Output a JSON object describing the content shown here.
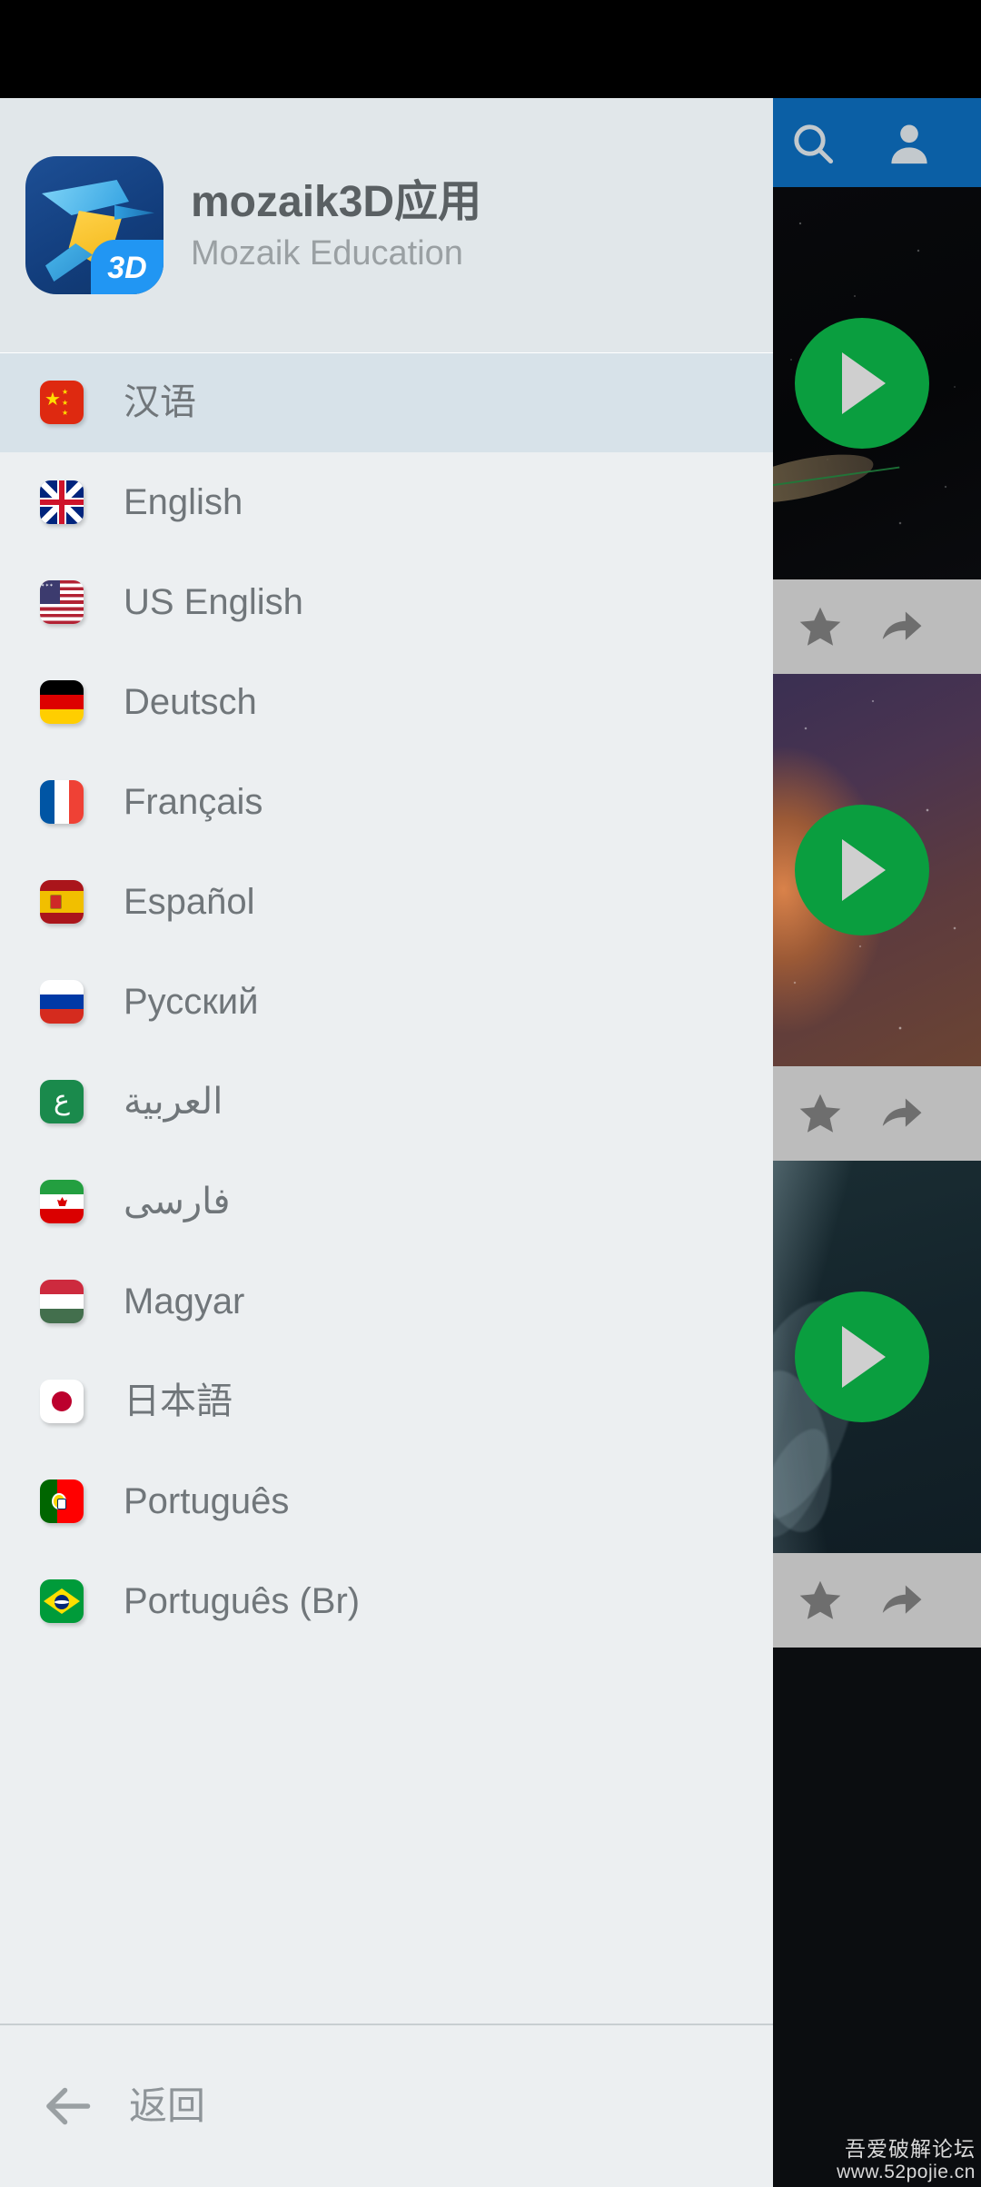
{
  "status_bar": {
    "visible": true
  },
  "drawer": {
    "header": {
      "app_title": "mozaik3D应用",
      "app_subtitle": "Mozaik Education",
      "logo_badge": "3D",
      "logo_icon": "hummingbird-logo"
    },
    "languages": [
      {
        "label": "汉语",
        "flag": "cn",
        "flag_name": "flag-china",
        "selected": true,
        "rtl": false,
        "glyph": ""
      },
      {
        "label": "English",
        "flag": "gb",
        "flag_name": "flag-united-kingdom",
        "selected": false,
        "rtl": false,
        "glyph": ""
      },
      {
        "label": "US English",
        "flag": "us",
        "flag_name": "flag-united-states",
        "selected": false,
        "rtl": false,
        "glyph": ""
      },
      {
        "label": "Deutsch",
        "flag": "de",
        "flag_name": "flag-germany",
        "selected": false,
        "rtl": false,
        "glyph": ""
      },
      {
        "label": "Français",
        "flag": "fr",
        "flag_name": "flag-france",
        "selected": false,
        "rtl": false,
        "glyph": ""
      },
      {
        "label": "Español",
        "flag": "es",
        "flag_name": "flag-spain",
        "selected": false,
        "rtl": false,
        "glyph": ""
      },
      {
        "label": "Русский",
        "flag": "ru",
        "flag_name": "flag-russia",
        "selected": false,
        "rtl": false,
        "glyph": ""
      },
      {
        "label": "العربية",
        "flag": "ar",
        "flag_name": "flag-arabic",
        "selected": false,
        "rtl": true,
        "glyph": "ع"
      },
      {
        "label": "فارسی",
        "flag": "ir",
        "flag_name": "flag-iran",
        "selected": false,
        "rtl": true,
        "glyph": ""
      },
      {
        "label": "Magyar",
        "flag": "hu",
        "flag_name": "flag-hungary",
        "selected": false,
        "rtl": false,
        "glyph": ""
      },
      {
        "label": "日本語",
        "flag": "jp",
        "flag_name": "flag-japan",
        "selected": false,
        "rtl": false,
        "glyph": ""
      },
      {
        "label": "Português",
        "flag": "pt",
        "flag_name": "flag-portugal",
        "selected": false,
        "rtl": false,
        "glyph": ""
      },
      {
        "label": "Português (Br)",
        "flag": "br",
        "flag_name": "flag-brazil",
        "selected": false,
        "rtl": false,
        "glyph": ""
      }
    ],
    "footer": {
      "back_label": "返回",
      "back_icon": "arrow-left-icon"
    }
  },
  "content": {
    "app_bar": {
      "background_color": "#0B5FA5",
      "search_icon": "search-icon",
      "account_icon": "account-icon"
    },
    "cards": [
      {
        "thumb_name": "space-planet-thumbnail",
        "play_icon": "play-icon",
        "favorite_icon": "star-icon",
        "share_icon": "share-icon"
      },
      {
        "thumb_name": "nebula-galaxy-thumbnail",
        "play_icon": "play-icon",
        "favorite_icon": "star-icon",
        "share_icon": "share-icon"
      },
      {
        "thumb_name": "smoke-dark-thumbnail",
        "play_icon": "play-icon",
        "favorite_icon": "star-icon",
        "share_icon": "share-icon"
      }
    ],
    "play_button_color": "#0a9e3f",
    "action_bar_color": "#bcbcbc"
  },
  "watermark": {
    "line1": "吾爱破解论坛",
    "line2": "www.52pojie.cn"
  }
}
